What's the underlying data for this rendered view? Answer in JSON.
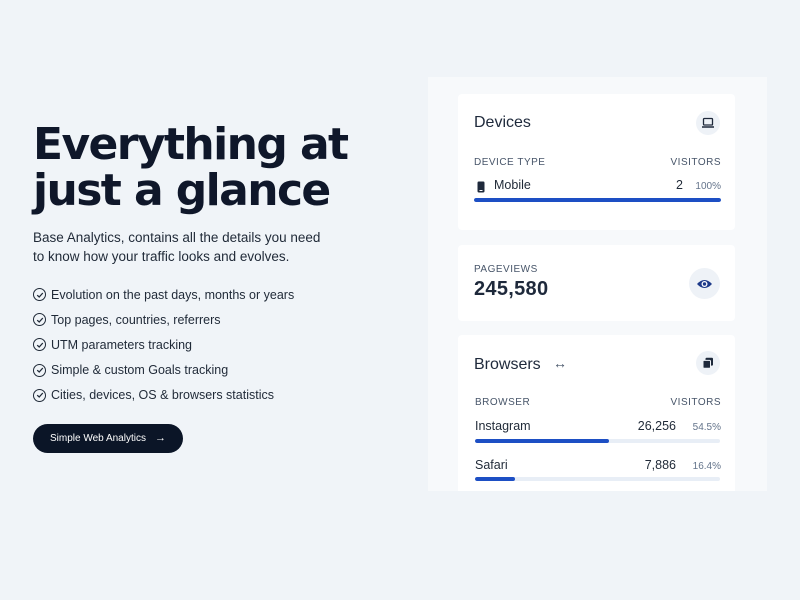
{
  "hero": {
    "title": "Everything at just a glance",
    "description": "Base Analytics, contains all the details you need to know how your traffic looks and evolves.",
    "features": [
      "Evolution on the past days, months or years",
      "Top pages, countries, referrers",
      "UTM parameters tracking",
      "Simple & custom Goals tracking",
      "Cities, devices, OS & browsers statistics"
    ],
    "cta_label": "Simple Web Analytics",
    "cta_icon": "arrow-right-icon"
  },
  "devices": {
    "title": "Devices",
    "icon": "laptop-icon",
    "col_type": "DEVICE TYPE",
    "col_visitors": "VISITORS",
    "rows": [
      {
        "icon": "smartphone-icon",
        "label": "Mobile",
        "count": "2",
        "percent": "100%",
        "fraction": 1.0
      }
    ]
  },
  "pageviews": {
    "label": "PAGEVIEWS",
    "value": "245,580",
    "icon": "eye-icon"
  },
  "browsers": {
    "title": "Browsers",
    "title_icon": "expand-arrows-icon",
    "icon": "copy-icon",
    "col_browser": "BROWSER",
    "col_visitors": "VISITORS",
    "rows": [
      {
        "label": "Instagram",
        "count": "26,256",
        "percent": "54.5%",
        "fraction": 0.545
      },
      {
        "label": "Safari",
        "count": "7,886",
        "percent": "16.4%",
        "fraction": 0.164
      }
    ]
  },
  "colors": {
    "background": "#f0f4f8",
    "accent_bar": "#1d4fc4",
    "cta_bg": "#0b1527",
    "eye_icon": "#1e3a8a"
  }
}
